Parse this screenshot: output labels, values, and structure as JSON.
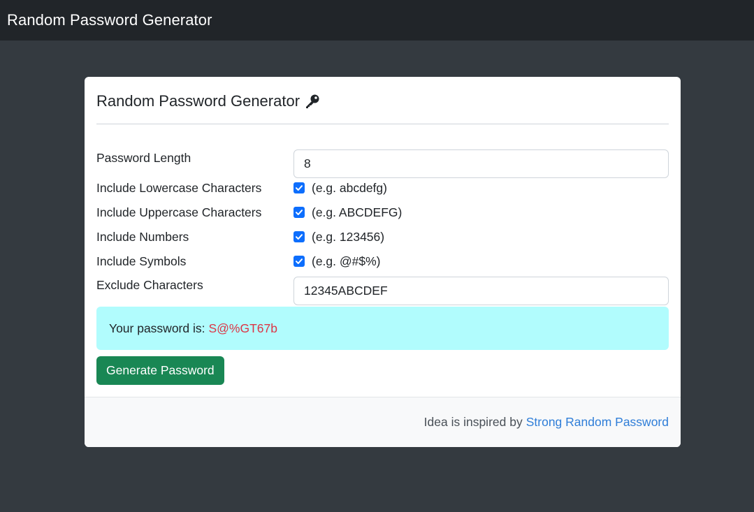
{
  "navbar": {
    "brand": "Random Password Generator"
  },
  "card": {
    "title": "Random Password Generator",
    "title_icon": "key-icon"
  },
  "form": {
    "length": {
      "label": "Password Length",
      "value": "8"
    },
    "lowercase": {
      "label": "Include Lowercase Characters",
      "checked": true,
      "hint": "(e.g. abcdefg)"
    },
    "uppercase": {
      "label": "Include Uppercase Characters",
      "checked": true,
      "hint": "(e.g. ABCDEFG)"
    },
    "numbers": {
      "label": "Include Numbers",
      "checked": true,
      "hint": "(e.g. 123456)"
    },
    "symbols": {
      "label": "Include Symbols",
      "checked": true,
      "hint": "(e.g. @#$%)"
    },
    "exclude": {
      "label": "Exclude Characters",
      "value": "12345ABCDEF"
    }
  },
  "result": {
    "prefix": "Your password is:",
    "password": "S@%GT67b"
  },
  "generate_button": "Generate Password",
  "footer": {
    "text": "Idea is inspired by",
    "link": "Strong Random Password"
  },
  "colors": {
    "page_bg": "#343a40",
    "navbar_bg": "#212529",
    "alert_bg": "#b1fcfd",
    "password_color": "#dc3545",
    "button_bg": "#198754",
    "checkbox": "#0d6efd",
    "link": "#2f7ed8"
  }
}
